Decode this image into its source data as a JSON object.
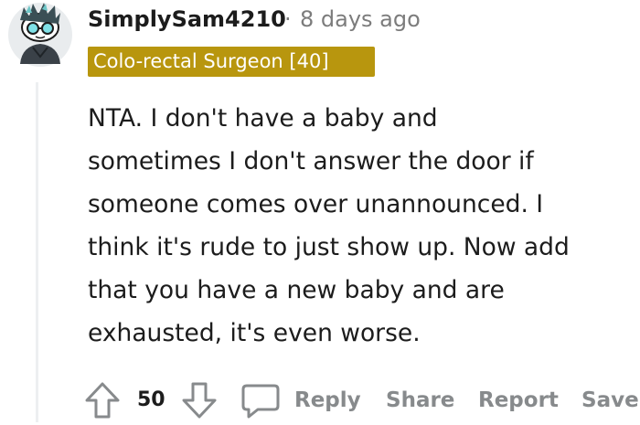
{
  "comment": {
    "username": "SimplySam4210",
    "separator": "·",
    "timestamp": "8 days ago",
    "flair": "Colo-rectal Surgeon [40]",
    "body_lines": [
      "NTA. I don't have a baby and",
      "sometimes I don't answer the door if",
      "someone comes over unannounced. I",
      "think it's rude to just show up. Now add",
      "that you have a new baby and are",
      "exhausted, it's even worse."
    ],
    "score": "50"
  },
  "actions": {
    "reply": "Reply",
    "share": "Share",
    "report": "Report",
    "save": "Save"
  },
  "colors": {
    "flair_bg": "#b8960e",
    "meta_text": "#7c7c7c",
    "action_text": "#878a8c",
    "thread_line": "#edeff1"
  },
  "icons": {
    "avatar": "snoo-avatar",
    "upvote": "upvote-arrow-icon",
    "downvote": "downvote-arrow-icon",
    "reply": "comment-bubble-icon"
  }
}
